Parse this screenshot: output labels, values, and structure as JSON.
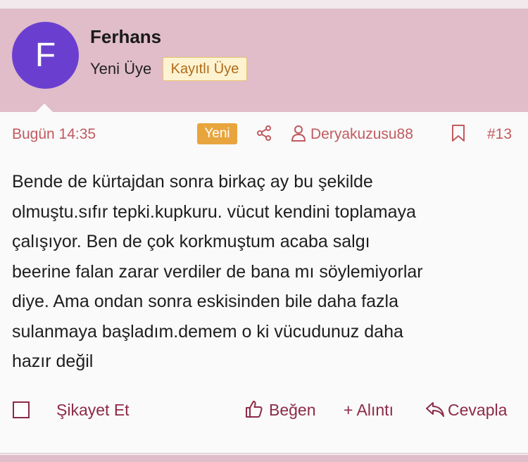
{
  "user": {
    "avatar_letter": "F",
    "name": "Ferhans",
    "title": "Yeni Üye",
    "role_badge": "Kayıtlı Üye"
  },
  "meta": {
    "date": "Bugün 14:35",
    "new_badge": "Yeni",
    "author": "Deryakuzusu88",
    "post_number": "#13"
  },
  "post": {
    "lines": [
      "Bende de kürtajdan sonra birkaç ay bu şekilde",
      "olmuştu.sıfır tepki.kupkuru. vücut kendini toplamaya",
      "çalışıyor. Ben de çok korkmuştum acaba salgı",
      "beerine falan zarar verdiler de bana mı söylemiyorlar",
      "diye. Ama ondan sonra eskisinden bile daha fazla",
      "sulanmaya başladım.demem o ki vücudunuz daha",
      "hazır değil"
    ]
  },
  "actions": {
    "report": "Şikayet Et",
    "like": "Beğen",
    "quote": "+ Alıntı",
    "reply": "Cevapla"
  },
  "colors": {
    "header_bg": "#e0bdc9",
    "avatar_bg": "#6a3fd0",
    "meta_text": "#c25a5f",
    "action_text": "#8d2a47",
    "new_badge": "#e8a53d"
  },
  "icons": {
    "share": "share-icon",
    "author": "user-icon",
    "bookmark": "bookmark-icon",
    "like": "thumbs-up-icon",
    "reply": "reply-arrow-icon"
  }
}
